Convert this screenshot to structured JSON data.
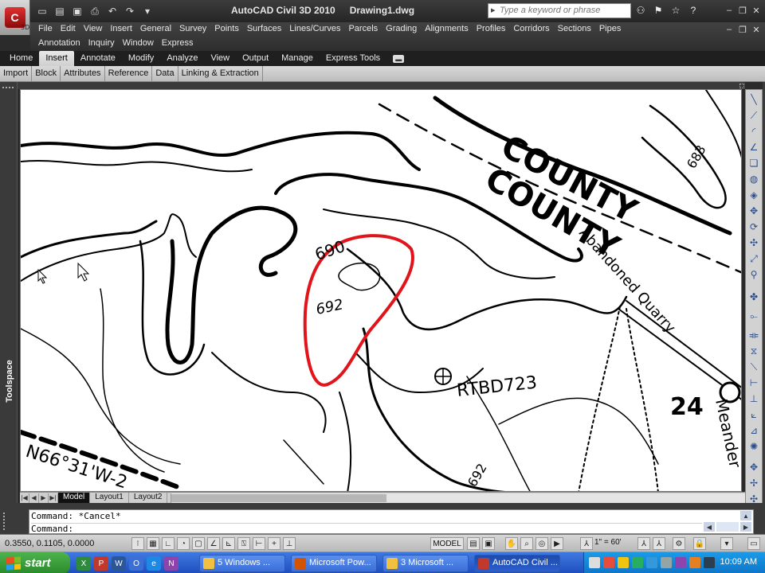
{
  "title_bar": {
    "app_name": "AutoCAD Civil 3D 2010",
    "document": "Drawing1.dwg",
    "app_button_version": "3D",
    "search_placeholder": "Type a keyword or phrase"
  },
  "menu": {
    "row1": [
      "File",
      "Edit",
      "View",
      "Insert",
      "General",
      "Survey",
      "Points",
      "Surfaces",
      "Lines/Curves",
      "Parcels",
      "Grading",
      "Alignments",
      "Profiles",
      "Corridors",
      "Sections",
      "Pipes"
    ],
    "row2": [
      "Annotation",
      "Inquiry",
      "Window",
      "Express"
    ]
  },
  "ribbon": {
    "tabs": [
      "Home",
      "Insert",
      "Annotate",
      "Modify",
      "Analyze",
      "View",
      "Output",
      "Manage",
      "Express Tools"
    ],
    "active_tab": "Insert",
    "panels": [
      "Import",
      "Block",
      "Attributes",
      "Reference",
      "Data",
      "Linking & Extraction"
    ]
  },
  "toolspace": {
    "label": "Toolspace"
  },
  "drawing": {
    "labels": {
      "county_1": "COUNTY",
      "county_2": "COUNTY",
      "contour_683": "683",
      "contour_690": "690",
      "contour_692": "692",
      "abandoned_quarry": "Abandoned Quarry",
      "rtbd": "RTBD723",
      "number_24": "24",
      "meander": "Meander",
      "bearing": "N66°31'W-2",
      "contour_692_road": "692"
    },
    "highlight_color": "#e0141a"
  },
  "layout_tabs": [
    "Model",
    "Layout1",
    "Layout2"
  ],
  "command_line": {
    "line1": "Command: *Cancel*",
    "line2": "Command:"
  },
  "status_bar": {
    "coords": "0.3550, 0.1105, 0.0000",
    "model": "MODEL",
    "scale": "1\" = 60'"
  },
  "taskbar": {
    "start": "start",
    "tasks": [
      "5 Windows ...",
      "Microsoft Pow...",
      "3 Microsoft ...",
      "AutoCAD Civil ..."
    ],
    "clock": "10:09 AM"
  }
}
